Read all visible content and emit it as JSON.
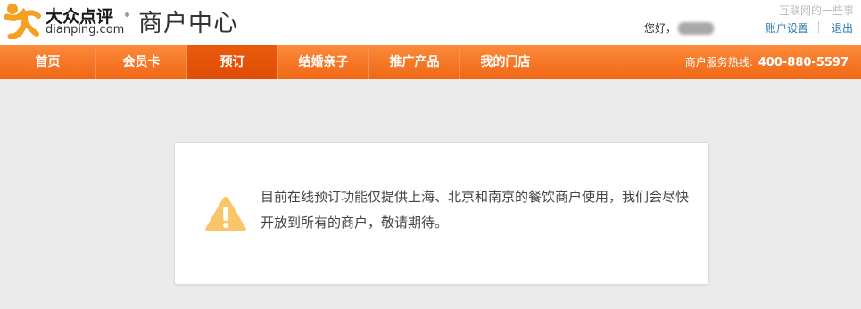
{
  "header": {
    "logo_cn": "大众点评",
    "logo_en": "dianping.com",
    "center_title": "商户中心",
    "slogan": "互联网的一些事",
    "greeting": "您好，",
    "account_settings": "账户设置",
    "logout": "退出"
  },
  "nav": {
    "items": [
      {
        "label": "首页"
      },
      {
        "label": "会员卡"
      },
      {
        "label": "预订"
      },
      {
        "label": "结婚亲子"
      },
      {
        "label": "推广产品"
      },
      {
        "label": "我的门店"
      }
    ],
    "active_index": 2,
    "hotline_label": "商户服务热线:",
    "hotline_number": "400-880-5597"
  },
  "notice": {
    "icon": "warning-icon",
    "message": "目前在线预订功能仅提供上海、北京和南京的餐饮商户使用，我们会尽快开放到所有的商户，敬请期待。"
  },
  "colors": {
    "nav_orange": "#f07020",
    "nav_active": "#e45408",
    "warning_yellow": "#fbc56a",
    "link_blue": "#2a7ab0"
  }
}
